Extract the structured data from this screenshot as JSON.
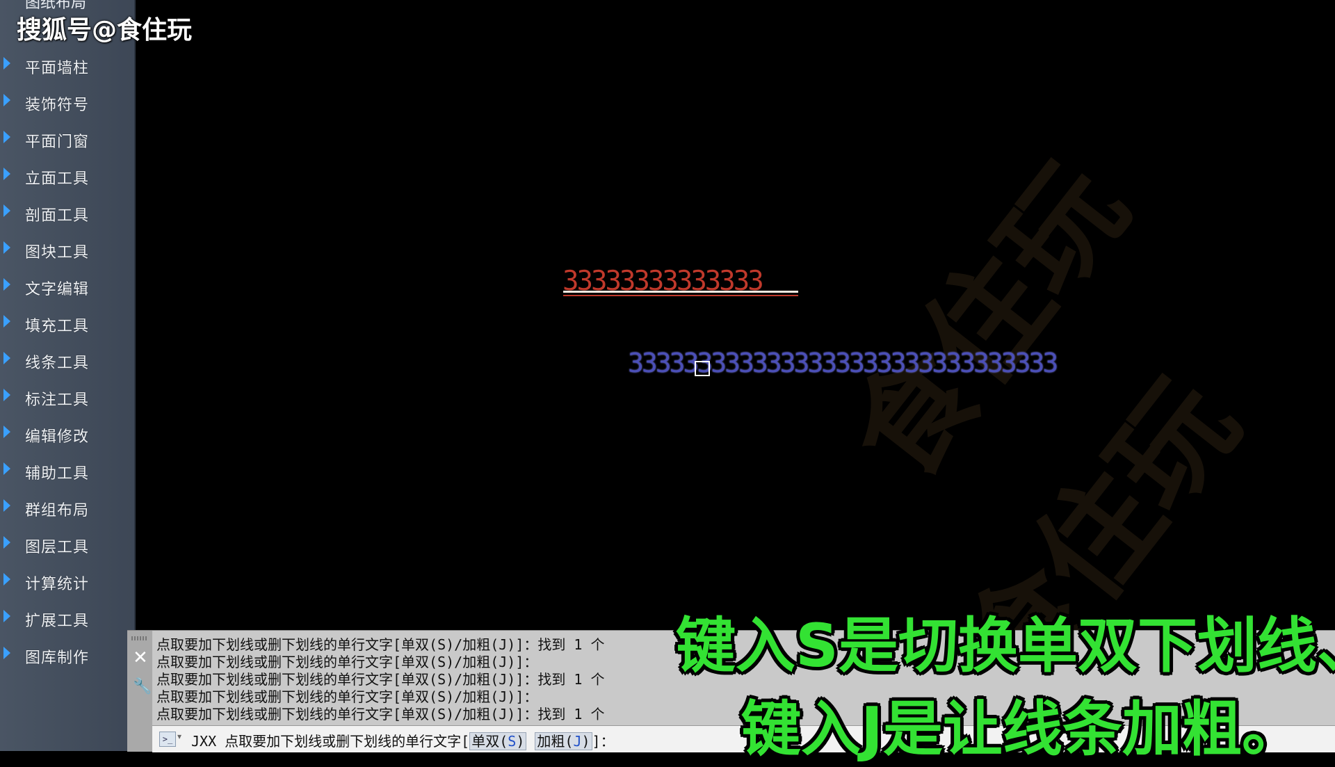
{
  "watermark": "搜狐号@食住玩",
  "sidebar": {
    "top_partial_label": "图纸布局",
    "items": [
      {
        "label": "平面墙柱"
      },
      {
        "label": "装饰符号"
      },
      {
        "label": "平面门窗"
      },
      {
        "label": "立面工具"
      },
      {
        "label": "剖面工具"
      },
      {
        "label": "图块工具"
      },
      {
        "label": "文字编辑"
      },
      {
        "label": "填充工具"
      },
      {
        "label": "线条工具"
      },
      {
        "label": "标注工具"
      },
      {
        "label": "编辑修改"
      },
      {
        "label": "辅助工具"
      },
      {
        "label": "群组布局"
      },
      {
        "label": "图层工具"
      },
      {
        "label": "计算统计"
      },
      {
        "label": "扩展工具"
      },
      {
        "label": "图库制作"
      }
    ]
  },
  "canvas": {
    "text_red": "33333333333333",
    "text_blue": "3333333333333333333333333333333",
    "watermark_diag": "食住玩"
  },
  "command": {
    "history": [
      "点取要加下划线或删下划线的单行文字[单双(S)/加粗(J)]：找到 1 个",
      "点取要加下划线或删下划线的单行文字[单双(S)/加粗(J)]：",
      "点取要加下划线或删下划线的单行文字[单双(S)/加粗(J)]：找到 1 个",
      "点取要加下划线或删下划线的单行文字[单双(S)/加粗(J)]：",
      "点取要加下划线或删下划线的单行文字[单双(S)/加粗(J)]：找到 1 个"
    ],
    "prompt_prefix": "JXX 点取要加下划线或删下划线的单行文字[",
    "option1_label": "单双(",
    "option1_key": "S",
    "option1_close": ")",
    "option2_label": "加粗(",
    "option2_key": "J",
    "option2_close": ")",
    "prompt_suffix": "]："
  },
  "subtitles": {
    "line1": "键入S是切换单双下划线、",
    "line2": "键入J是让线条加粗。"
  },
  "colors": {
    "sidebar_bg": "#434d5b",
    "triangle": "#3aa0ff",
    "text_red": "#c0392b",
    "text_blue": "#4b4fb8",
    "subtitle_green": "#33e233"
  }
}
